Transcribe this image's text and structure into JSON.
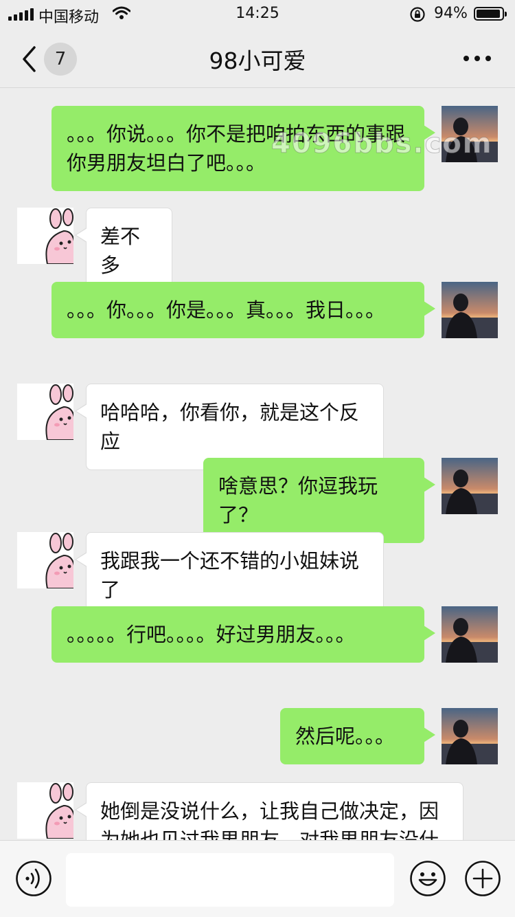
{
  "status_bar": {
    "carrier": "中国移动",
    "time": "14:25",
    "battery_percent_text": "94%",
    "battery_level": 0.94,
    "icons": [
      "signal-icon",
      "wifi-icon",
      "rotation-lock-icon",
      "battery-icon"
    ]
  },
  "nav": {
    "back_icon": "chevron-left-icon",
    "unread_count": "7",
    "title": "98小可爱",
    "more_icon": "more-icon"
  },
  "watermark": "4096bbs.com",
  "messages": [
    {
      "side": "me",
      "text": "。。。你说。。。你不是把咱拍东西的事跟你男朋友坦白了吧。。。"
    },
    {
      "side": "other",
      "text": "差不多"
    },
    {
      "side": "me",
      "text": "。。。你。。。你是。。。真。。。我日。。。"
    },
    {
      "side": "other",
      "text": "哈哈哈，你看你，就是这个反应"
    },
    {
      "side": "me",
      "text": "啥意思？你逗我玩了？"
    },
    {
      "side": "other",
      "text": "我跟我一个还不错的小姐妹说了"
    },
    {
      "side": "me",
      "text": "。。。。。行吧。。。。好过男朋友。。。"
    },
    {
      "side": "me",
      "text": "然后呢。。。"
    },
    {
      "side": "other",
      "text": "她倒是没说什么，让我自己做决定，因为她也见过我男朋友，对我男朋友没什么好"
    }
  ],
  "input_bar": {
    "voice_icon": "voice-icon",
    "input_value": "",
    "emoji_icon": "emoji-icon",
    "plus_icon": "plus-icon"
  },
  "colors": {
    "background": "#ededed",
    "my_bubble": "#95ec69",
    "other_bubble": "#ffffff",
    "bunny_pink": "#f7c7d6"
  }
}
